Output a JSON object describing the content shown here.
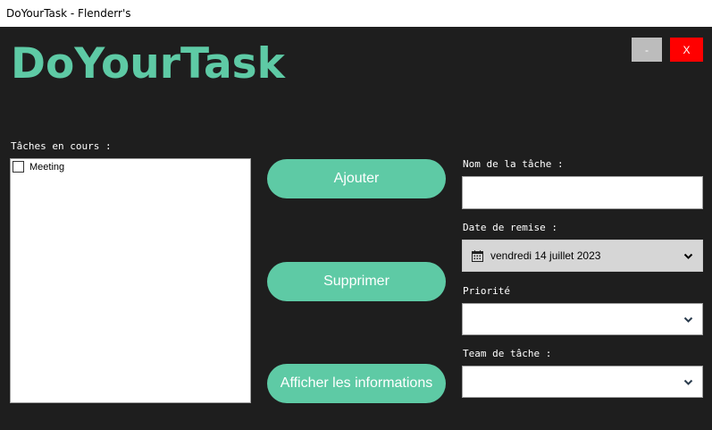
{
  "window": {
    "title": "DoYourTask - Flenderr's"
  },
  "header": {
    "logo": "DoYourTask",
    "minimize_label": "-",
    "close_label": "X"
  },
  "tasks": {
    "label": "Tâches en cours :",
    "items": [
      {
        "label": "Meeting",
        "checked": false
      }
    ]
  },
  "actions": {
    "add_label": "Ajouter",
    "delete_label": "Supprimer",
    "info_label": "Afficher les informations"
  },
  "form": {
    "name_label": "Nom de la tâche :",
    "name_value": "",
    "date_label": "Date de remise :",
    "date_value": "vendredi 14 juillet 2023",
    "priority_label": "Priorité",
    "priority_value": "",
    "team_label": "Team de tâche :",
    "team_value": ""
  },
  "colors": {
    "accent": "#5ecaa5",
    "background": "#1e1e1e",
    "close": "#ff0000",
    "minimize": "#bcbcbc"
  }
}
